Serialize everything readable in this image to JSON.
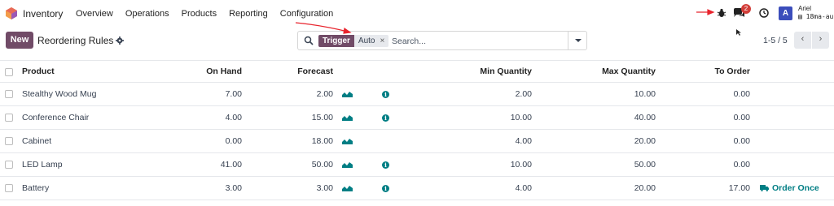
{
  "app": {
    "name": "Inventory"
  },
  "menu": [
    "Overview",
    "Operations",
    "Products",
    "Reporting",
    "Configuration"
  ],
  "systray": {
    "chat_count": "2",
    "avatar_letter": "A",
    "user_name": "Ariel",
    "user_db": "18ma-au"
  },
  "control": {
    "new_label": "New",
    "title": "Reordering Rules"
  },
  "search": {
    "facet_name": "Trigger",
    "facet_value": "Auto",
    "facet_remove": "×",
    "placeholder": "Search..."
  },
  "pager": {
    "value": "1-5 / 5",
    "prev": "‹",
    "next": "›"
  },
  "columns": {
    "product": "Product",
    "on_hand": "On Hand",
    "forecast": "Forecast",
    "min_qty": "Min Quantity",
    "max_qty": "Max Quantity",
    "to_order": "To Order"
  },
  "rows": [
    {
      "product": "Stealthy Wood Mug",
      "on_hand": "7.00",
      "forecast": "2.00",
      "min_qty": "2.00",
      "max_qty": "10.00",
      "to_order": "0.00",
      "action": ""
    },
    {
      "product": "Conference Chair",
      "on_hand": "4.00",
      "forecast": "15.00",
      "min_qty": "10.00",
      "max_qty": "40.00",
      "to_order": "0.00",
      "action": ""
    },
    {
      "product": "Cabinet",
      "on_hand": "0.00",
      "forecast": "18.00",
      "min_qty": "4.00",
      "max_qty": "20.00",
      "to_order": "0.00",
      "action": ""
    },
    {
      "product": "LED Lamp",
      "on_hand": "41.00",
      "forecast": "50.00",
      "min_qty": "10.00",
      "max_qty": "50.00",
      "to_order": "0.00",
      "action": ""
    },
    {
      "product": "Battery",
      "on_hand": "3.00",
      "forecast": "3.00",
      "min_qty": "4.00",
      "max_qty": "20.00",
      "to_order": "17.00",
      "action": "Order Once"
    }
  ],
  "colors": {
    "brand": "#714b67",
    "teal": "#017e84",
    "badge": "#d23f3a",
    "avatar": "#3b4dbb",
    "annotation": "#e8232c"
  },
  "icons": [
    "inventory-logo-icon",
    "bug-icon",
    "chat-icon",
    "clock-icon",
    "gear-icon",
    "search-icon",
    "graph-icon",
    "info-icon",
    "truck-icon"
  ]
}
